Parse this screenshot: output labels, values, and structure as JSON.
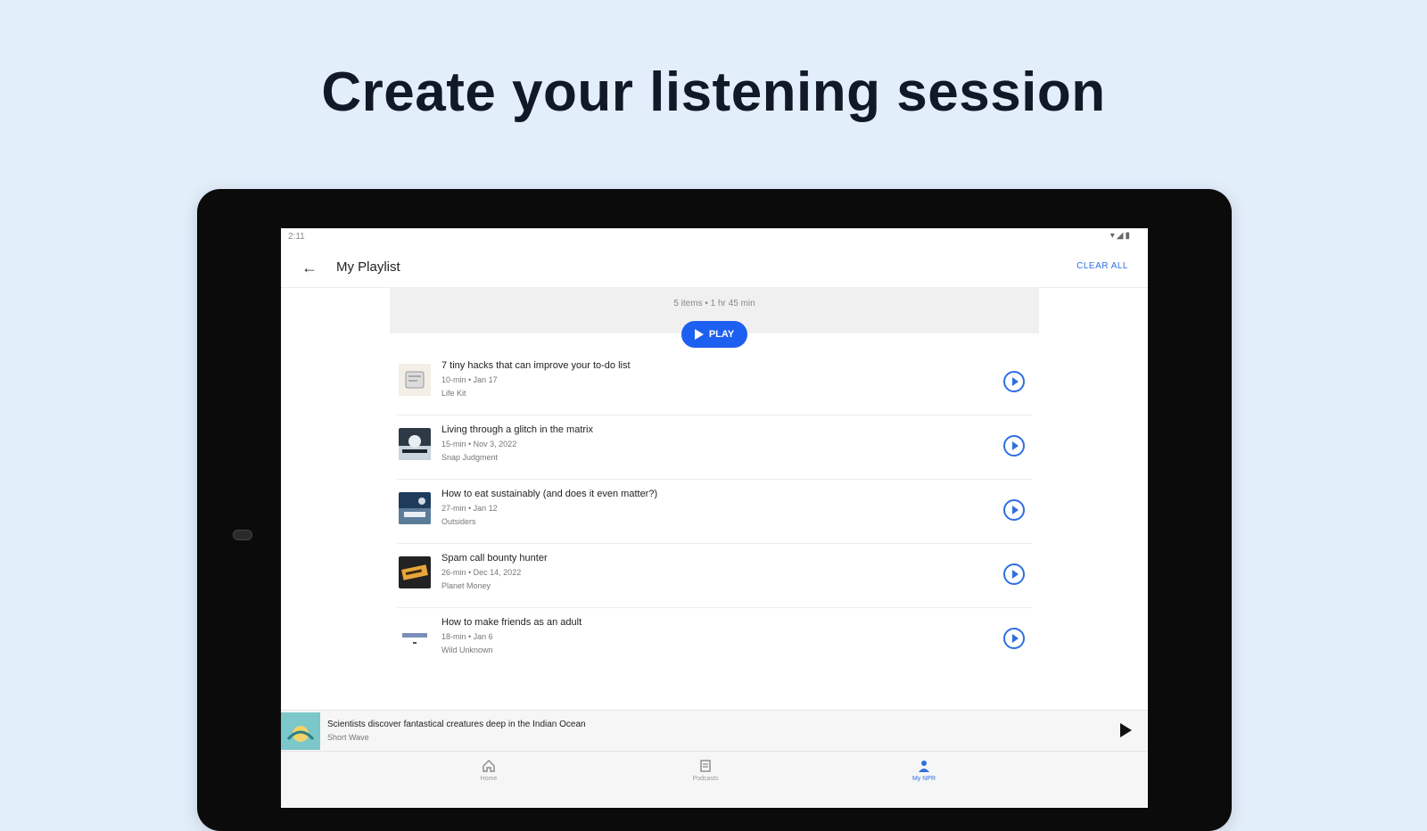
{
  "headline": "Create your listening session",
  "status": {
    "time": "2:11",
    "icons": "▾◢▮"
  },
  "appbar": {
    "title": "My Playlist",
    "clear_label": "CLEAR ALL"
  },
  "summary": {
    "text": "5 items • 1 hr 45 min",
    "play_label": "PLAY"
  },
  "episodes": [
    {
      "title": "7 tiny hacks that can improve your to-do list",
      "meta": "10-min • Jan 17",
      "show": "Life Kit"
    },
    {
      "title": "Living through a glitch in the matrix",
      "meta": "15-min • Nov 3, 2022",
      "show": "Snap Judgment"
    },
    {
      "title": "How to eat sustainably (and does it even matter?)",
      "meta": "27-min • Jan 12",
      "show": "Outsiders"
    },
    {
      "title": "Spam call bounty hunter",
      "meta": "26-min • Dec 14, 2022",
      "show": "Planet Money"
    },
    {
      "title": "How to make friends as an adult",
      "meta": "18-min • Jan 6",
      "show": "Wild Unknown"
    }
  ],
  "miniplayer": {
    "title": "Scientists discover fantastical creatures deep in the Indian Ocean",
    "show": "Short Wave"
  },
  "nav": [
    {
      "label": "Home",
      "icon": "home-icon",
      "active": false
    },
    {
      "label": "Podcasts",
      "icon": "podcasts-icon",
      "active": false
    },
    {
      "label": "My NPR",
      "icon": "person-icon",
      "active": true
    }
  ],
  "colors": {
    "accent": "#1d5ff0",
    "background": "#e3eefb"
  }
}
